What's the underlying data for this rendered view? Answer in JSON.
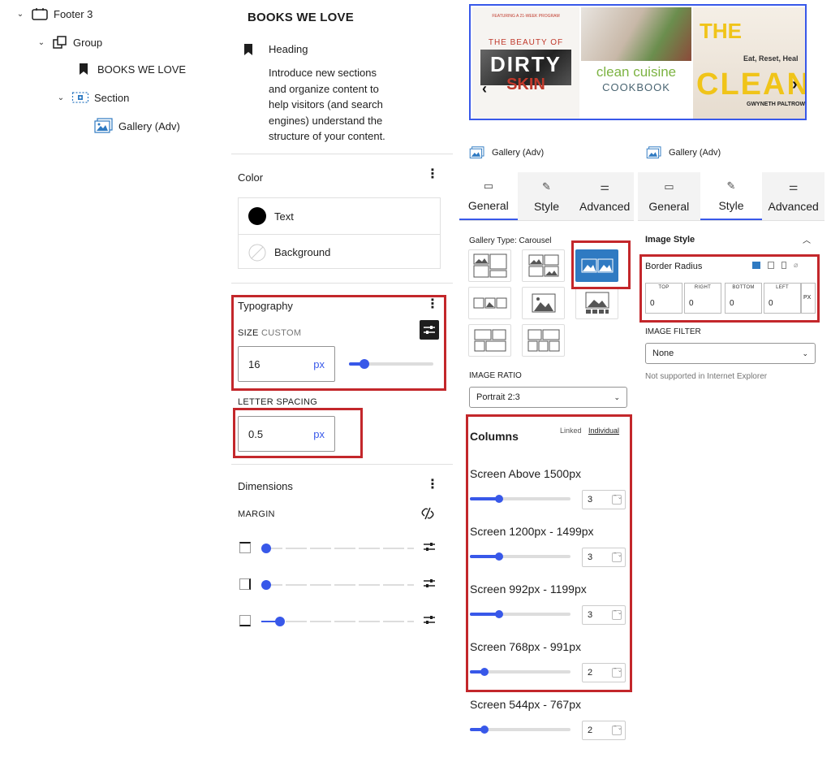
{
  "tree": {
    "footer": "Footer 3",
    "group": "Group",
    "books": "BOOKS WE LOVE",
    "section": "Section",
    "gallery": "Gallery (Adv)"
  },
  "heading_card": {
    "title": "BOOKS WE LOVE",
    "block_name": "Heading",
    "description_lines": [
      "Introduce new sections",
      "and organize content to",
      "help visitors (and search",
      "engines) understand the",
      "structure of your content."
    ]
  },
  "color_panel": {
    "title": "Color",
    "text_label": "Text",
    "background_label": "Background"
  },
  "typography": {
    "title": "Typography",
    "size_label": "SIZE",
    "size_mode": "CUSTOM",
    "size_value": "16",
    "size_unit": "px",
    "size_slider_fraction": 0.18,
    "letter_spacing_label": "LETTER SPACING",
    "letter_spacing_value": "0.5",
    "letter_spacing_unit": "px"
  },
  "dimensions": {
    "title": "Dimensions",
    "margin_label": "MARGIN",
    "sliders": [
      0.0,
      0.0,
      0.12
    ]
  },
  "carousel": {
    "books": [
      {
        "top": "FEATURING A 21-WEEK PROGRAM",
        "title1": "THE BEAUTY OF",
        "title2": "DIRTY",
        "title3": "SKIN"
      },
      {
        "title1": "clean cuisine",
        "title2": "COOKBOOK"
      },
      {
        "title1": "Eat, Reset, Heal",
        "title2": "THE",
        "title3": "CLEAN",
        "author": "GWYNETH PALTROW"
      }
    ],
    "prev_icon": "chevron-left-icon",
    "next_icon": "chevron-right-icon"
  },
  "general_panel": {
    "block_name": "Gallery (Adv)",
    "tabs": [
      "General",
      "Style",
      "Advanced"
    ],
    "active_tab": "General",
    "gallery_type_label": "Gallery Type: Carousel",
    "image_ratio_label": "IMAGE RATIO",
    "image_ratio_value": "Portrait 2:3",
    "columns_title": "Columns",
    "linked_label": "Linked",
    "individual_label": "Individual",
    "screens": [
      {
        "label": "Screen Above 1500px",
        "value": "3",
        "fraction": 0.3
      },
      {
        "label": "Screen 1200px - 1499px",
        "value": "3",
        "fraction": 0.3
      },
      {
        "label": "Screen 992px - 1199px",
        "value": "3",
        "fraction": 0.3
      },
      {
        "label": "Screen 768px - 991px",
        "value": "2",
        "fraction": 0.15
      },
      {
        "label": "Screen 544px - 767px",
        "value": "2",
        "fraction": 0.15
      }
    ]
  },
  "style_panel": {
    "block_name": "Gallery (Adv)",
    "tabs": [
      "General",
      "Style",
      "Advanced"
    ],
    "active_tab": "Style",
    "image_style_label": "Image Style",
    "border_radius_label": "Border Radius",
    "radius": [
      {
        "cap": "TOP",
        "value": "0"
      },
      {
        "cap": "RIGHT",
        "value": "0"
      },
      {
        "cap": "BOTTOM",
        "value": "0"
      },
      {
        "cap": "LEFT",
        "value": "0"
      }
    ],
    "radius_unit": "PX",
    "image_filter_label": "IMAGE FILTER",
    "image_filter_value": "None",
    "ie_note": "Not supported in Internet Explorer"
  },
  "colors": {
    "accent": "#3858e9",
    "highlight": "#c3272b",
    "gallery_active": "#2f7ac2"
  }
}
